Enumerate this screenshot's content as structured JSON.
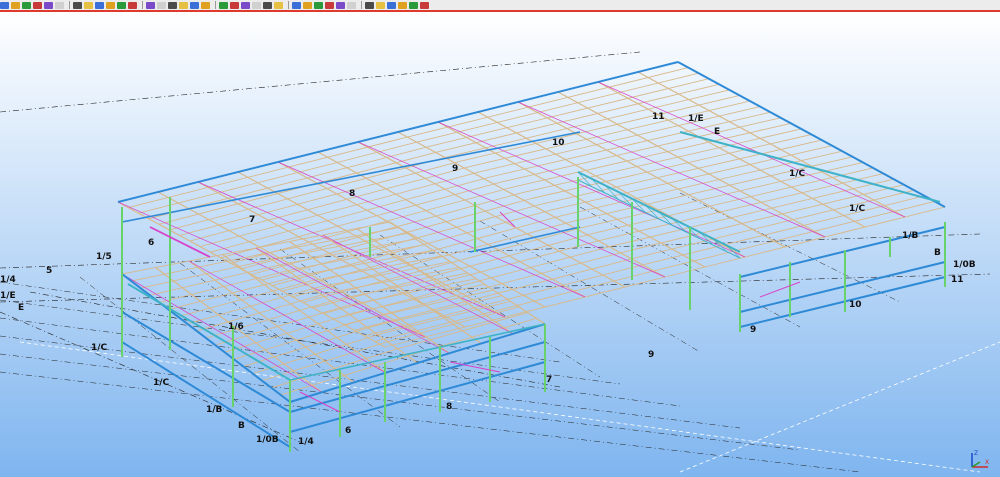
{
  "toolbar": {
    "icons": [
      "select-icon",
      "line-icon",
      "arrow-icon",
      "pen-icon",
      "eraser-icon",
      "binoculars-icon",
      "grid-icon",
      "snap-icon",
      "node-icon",
      "bar-icon",
      "support-icon",
      "load-icon",
      "section-icon",
      "release-icon",
      "offset-icon",
      "cut-icon",
      "copy-icon",
      "paste-icon",
      "undo-icon",
      "redo-icon",
      "zoom-icon",
      "pan-icon",
      "rotate-icon",
      "view-3d-icon",
      "view-xy-icon",
      "view-xz-icon",
      "view-yz-icon",
      "display-icon",
      "render-icon",
      "calc-icon",
      "results-icon",
      "report-icon",
      "print-icon",
      "export-icon",
      "settings-icon",
      "help-icon"
    ]
  },
  "colors": {
    "bg_top": "#ffffff",
    "bg_bottom": "#7fb5ef",
    "beam": "#d8b98a",
    "column": "#67d36a",
    "brace": "#d940c9",
    "main_beam": "#2e8ad6",
    "truss": "#3fb2c8",
    "grid": "#222222"
  },
  "grid_labels": {
    "top": [
      "11",
      "1/E",
      "E",
      "10",
      "9",
      "8",
      "7",
      "6",
      "1/5",
      "5"
    ],
    "right": [
      "1/C",
      "1/C",
      "1/B",
      "B",
      "1/0B",
      "11",
      "10",
      "9"
    ],
    "left": [
      "1/4",
      "1/E",
      "E",
      "5",
      "1/C",
      "1/C",
      "1/B",
      "B",
      "1/0B",
      "1/4",
      "1/6"
    ],
    "front": [
      "6",
      "7",
      "8",
      "9"
    ]
  },
  "gizmo": {
    "z": "Z",
    "x": "X"
  }
}
